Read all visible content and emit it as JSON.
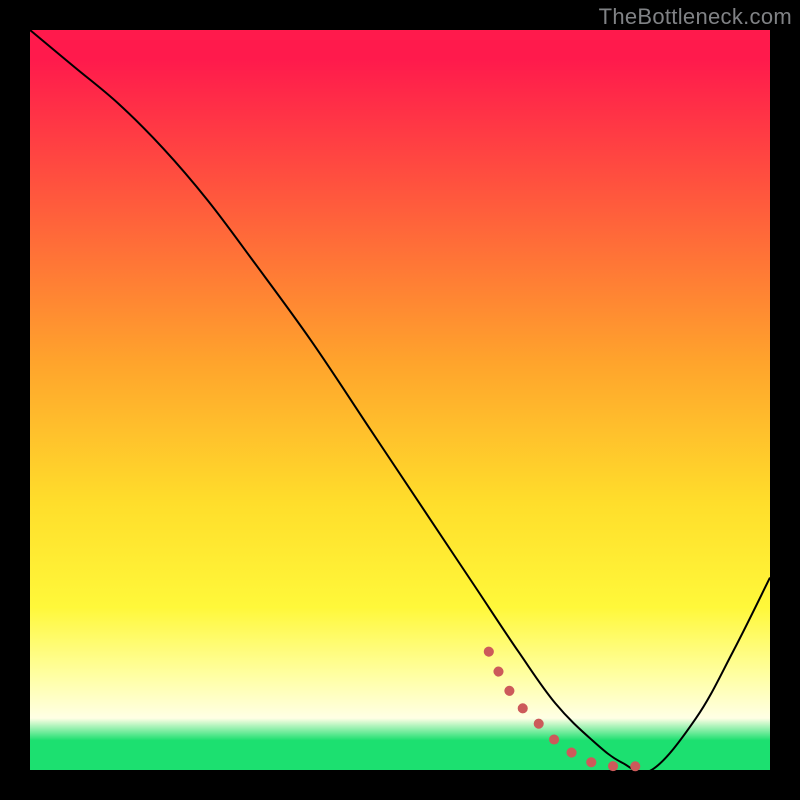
{
  "watermark": "TheBottleneck.com",
  "chart_data": {
    "type": "line",
    "title": "",
    "xlabel": "",
    "ylabel": "",
    "xlim": [
      0,
      100
    ],
    "ylim": [
      0,
      100
    ],
    "gradient_stops": [
      {
        "pos": 0,
        "color": "#ff1a4c"
      },
      {
        "pos": 20,
        "color": "#ff4f3f"
      },
      {
        "pos": 45,
        "color": "#ffa42c"
      },
      {
        "pos": 64,
        "color": "#ffde2b"
      },
      {
        "pos": 78,
        "color": "#fff83a"
      },
      {
        "pos": 87,
        "color": "#ffffa0"
      },
      {
        "pos": 93,
        "color": "#ffffe5"
      },
      {
        "pos": 96,
        "color": "#1ce070"
      },
      {
        "pos": 100,
        "color": "#1ce070"
      }
    ],
    "series": [
      {
        "name": "bottleneck-curve",
        "stroke": "#000000",
        "stroke_width": 2,
        "x": [
          0,
          6,
          12,
          18,
          24,
          30,
          38,
          46,
          54,
          60,
          66,
          71,
          76,
          80,
          84,
          90,
          95,
          100
        ],
        "y": [
          100,
          95,
          90,
          84,
          77,
          69,
          58,
          46,
          34,
          25,
          16,
          9,
          4,
          1,
          0,
          7,
          16,
          26
        ]
      },
      {
        "name": "highlight-curve",
        "stroke": "#cc5a5a",
        "stroke_width": 10,
        "linecap": "round",
        "dash": "0.1 20",
        "x": [
          62,
          64,
          66,
          68,
          70,
          72,
          74,
          76,
          79,
          82,
          84
        ],
        "y": [
          16,
          12,
          9,
          7,
          5,
          3,
          2,
          1,
          0.5,
          0.5,
          0.5
        ]
      }
    ]
  }
}
